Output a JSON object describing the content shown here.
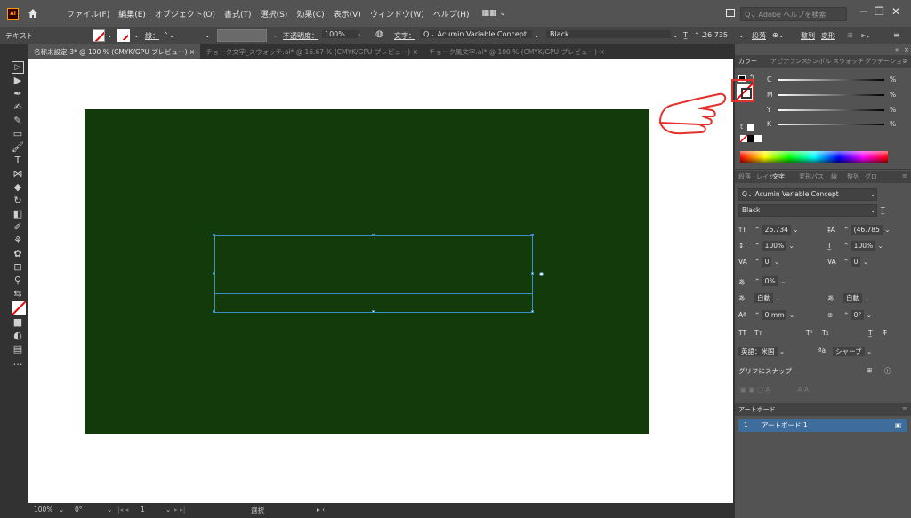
{
  "menubar": {
    "logo": "Ai",
    "items": [
      "ファイル(F)",
      "編集(E)",
      "オブジェクト(O)",
      "書式(T)",
      "選択(S)",
      "効果(C)",
      "表示(V)",
      "ウィンドウ(W)",
      "ヘルプ(H)"
    ],
    "workspace": "▦▦ ⌄",
    "search_placeholder": "Q⌄ Adobe ヘルプを検索"
  },
  "controlbar": {
    "mode": "テキスト",
    "stroke_label": "線：",
    "opacity_label": "不透明度：",
    "opacity_value": "100%",
    "character_label": "文字：",
    "font_family": "Acumin Variable Concept",
    "font_style": "Black",
    "font_size": "26.735",
    "paragraph_label": "段落",
    "align_label": "整列",
    "transform_label": "変形"
  },
  "tabs": [
    {
      "label": "名称未設定-3* @ 100 % (CMYK/GPU プレビュー)",
      "active": true
    },
    {
      "label": "チョーク文字_スウォッチ.ai* @ 16.67 % (CMYK/GPU プレビュー)",
      "active": false
    },
    {
      "label": "チョーク風文字.ai* @ 100 % (CMYK/GPU プレビュー)",
      "active": false
    }
  ],
  "tab_close": "×",
  "statusbar": {
    "zoom": "100%",
    "rotation": "0°",
    "artboard_num": "1",
    "tool": "選択"
  },
  "color_panel": {
    "tabs": [
      "カラー",
      "アピアランス",
      "シンボル",
      "スウォッチ",
      "グラデーション"
    ],
    "channels": [
      {
        "label": "C",
        "value": "%"
      },
      {
        "label": "M",
        "value": "%"
      },
      {
        "label": "Y",
        "value": "%"
      },
      {
        "label": "K",
        "value": "%"
      }
    ]
  },
  "char_panel": {
    "tabs": [
      "段落",
      "レイヤー",
      "文字",
      "変形",
      "パス",
      "線",
      "整列",
      "グロ"
    ],
    "font_family": "Acumin Variable Concept",
    "font_style": "Black",
    "size": "26.734",
    "leading": "(46.785",
    "vscale": "100%",
    "hscale": "100%",
    "kerning": "0",
    "tracking": "0",
    "tsume": "0%",
    "aki_left": "自動",
    "aki_right": "自動",
    "baseline": "0 mm",
    "rotation": "0°",
    "lang": "英語：米国",
    "aa": "シャープ",
    "snap": "グリフにスナップ"
  },
  "artboard_panel": {
    "title": "アートボード",
    "row_num": "1",
    "row_name": "アートボード 1"
  },
  "colors": {
    "artboard": "#133a0a",
    "selection": "#3e8fc6",
    "highlight": "#e3302a",
    "accent_row": "#3e6c9b"
  }
}
